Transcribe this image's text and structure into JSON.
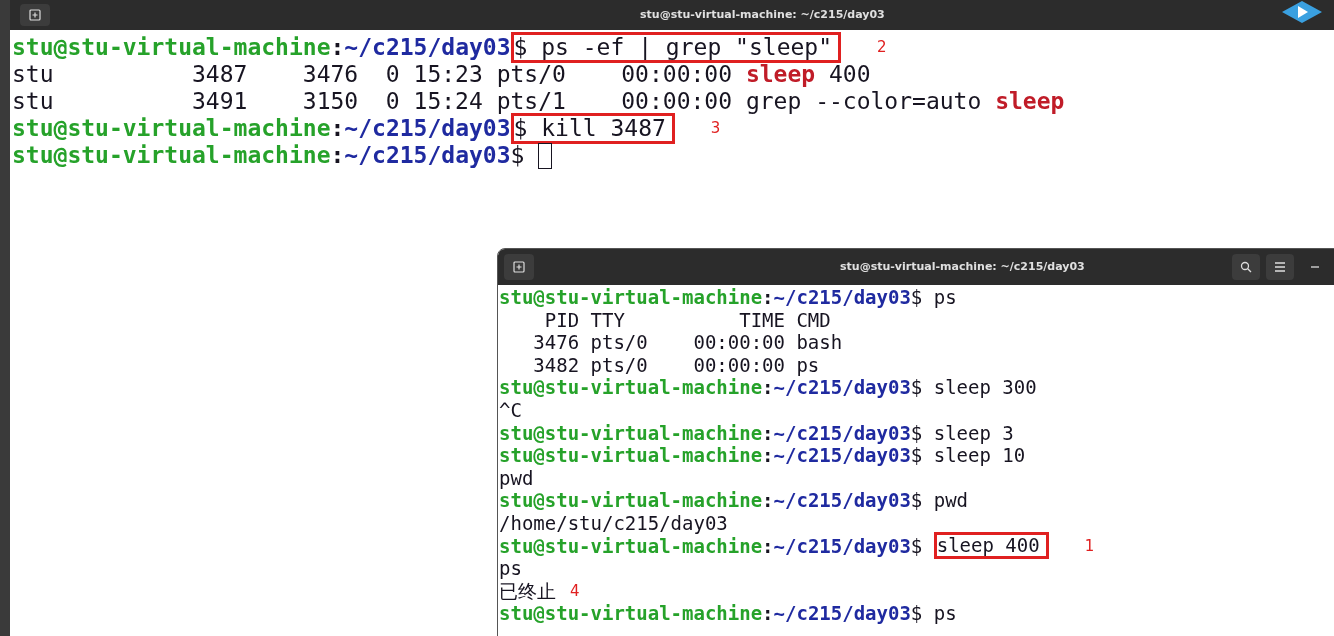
{
  "main_terminal": {
    "title": "stu@stu-virtual-machine: ~/c215/day03",
    "cursor": true,
    "lines": [
      {
        "segments": [
          {
            "kind": "user",
            "text": "stu@stu-virtual-machine"
          },
          {
            "kind": "sep",
            "text": ":"
          },
          {
            "kind": "path",
            "text": "~/c215/day03"
          },
          {
            "kind": "text",
            "text": "$ ps -ef | grep \"sleep\"",
            "mark": "2"
          }
        ]
      },
      {
        "segments": [
          {
            "kind": "text",
            "text": "stu          3487    3476  0 15:23 pts/0    00:00:00 "
          },
          {
            "kind": "match",
            "text": "sleep"
          },
          {
            "kind": "text",
            "text": " 400"
          }
        ]
      },
      {
        "segments": [
          {
            "kind": "text",
            "text": "stu          3491    3150  0 15:24 pts/1    00:00:00 grep --color=auto "
          },
          {
            "kind": "match",
            "text": "sleep"
          }
        ]
      },
      {
        "segments": [
          {
            "kind": "user",
            "text": "stu@stu-virtual-machine"
          },
          {
            "kind": "sep",
            "text": ":"
          },
          {
            "kind": "path",
            "text": "~/c215/day03"
          },
          {
            "kind": "text",
            "text": "$ kill 3487",
            "mark": "3"
          }
        ]
      },
      {
        "segments": [
          {
            "kind": "user",
            "text": "stu@stu-virtual-machine"
          },
          {
            "kind": "sep",
            "text": ":"
          },
          {
            "kind": "path",
            "text": "~/c215/day03"
          },
          {
            "kind": "text",
            "text": "$ "
          }
        ]
      }
    ]
  },
  "second_terminal": {
    "title": "stu@stu-virtual-machine: ~/c215/day03",
    "lines": [
      {
        "segments": [
          {
            "kind": "user",
            "text": "stu@stu-virtual-machine"
          },
          {
            "kind": "sep",
            "text": ":"
          },
          {
            "kind": "path",
            "text": "~/c215/day03"
          },
          {
            "kind": "text",
            "text": "$ ps"
          }
        ]
      },
      {
        "segments": [
          {
            "kind": "text",
            "text": "    PID TTY          TIME CMD"
          }
        ]
      },
      {
        "segments": [
          {
            "kind": "text",
            "text": "   3476 pts/0    00:00:00 bash"
          }
        ]
      },
      {
        "segments": [
          {
            "kind": "text",
            "text": "   3482 pts/0    00:00:00 ps"
          }
        ]
      },
      {
        "segments": [
          {
            "kind": "user",
            "text": "stu@stu-virtual-machine"
          },
          {
            "kind": "sep",
            "text": ":"
          },
          {
            "kind": "path",
            "text": "~/c215/day03"
          },
          {
            "kind": "text",
            "text": "$ sleep 300"
          }
        ]
      },
      {
        "segments": [
          {
            "kind": "text",
            "text": "^C"
          }
        ]
      },
      {
        "segments": [
          {
            "kind": "user",
            "text": "stu@stu-virtual-machine"
          },
          {
            "kind": "sep",
            "text": ":"
          },
          {
            "kind": "path",
            "text": "~/c215/day03"
          },
          {
            "kind": "text",
            "text": "$ sleep 3"
          }
        ]
      },
      {
        "segments": [
          {
            "kind": "user",
            "text": "stu@stu-virtual-machine"
          },
          {
            "kind": "sep",
            "text": ":"
          },
          {
            "kind": "path",
            "text": "~/c215/day03"
          },
          {
            "kind": "text",
            "text": "$ sleep 10"
          }
        ]
      },
      {
        "segments": [
          {
            "kind": "text",
            "text": "pwd"
          }
        ]
      },
      {
        "segments": [
          {
            "kind": "user",
            "text": "stu@stu-virtual-machine"
          },
          {
            "kind": "sep",
            "text": ":"
          },
          {
            "kind": "path",
            "text": "~/c215/day03"
          },
          {
            "kind": "text",
            "text": "$ pwd"
          }
        ]
      },
      {
        "segments": [
          {
            "kind": "text",
            "text": "/home/stu/c215/day03"
          }
        ]
      },
      {
        "segments": [
          {
            "kind": "user",
            "text": "stu@stu-virtual-machine"
          },
          {
            "kind": "sep",
            "text": ":"
          },
          {
            "kind": "path",
            "text": "~/c215/day03"
          },
          {
            "kind": "text",
            "text": "$ "
          },
          {
            "kind": "text",
            "text": "sleep 400",
            "mark": "1"
          }
        ]
      },
      {
        "segments": [
          {
            "kind": "text",
            "text": "ps"
          }
        ]
      },
      {
        "segments": [
          {
            "kind": "text",
            "text": "已终止"
          },
          {
            "kind": "note",
            "text": "4"
          }
        ]
      },
      {
        "segments": [
          {
            "kind": "user",
            "text": "stu@stu-virtual-machine"
          },
          {
            "kind": "sep",
            "text": ":"
          },
          {
            "kind": "path",
            "text": "~/c215/day03"
          },
          {
            "kind": "text",
            "text": "$ ps"
          }
        ]
      }
    ]
  }
}
